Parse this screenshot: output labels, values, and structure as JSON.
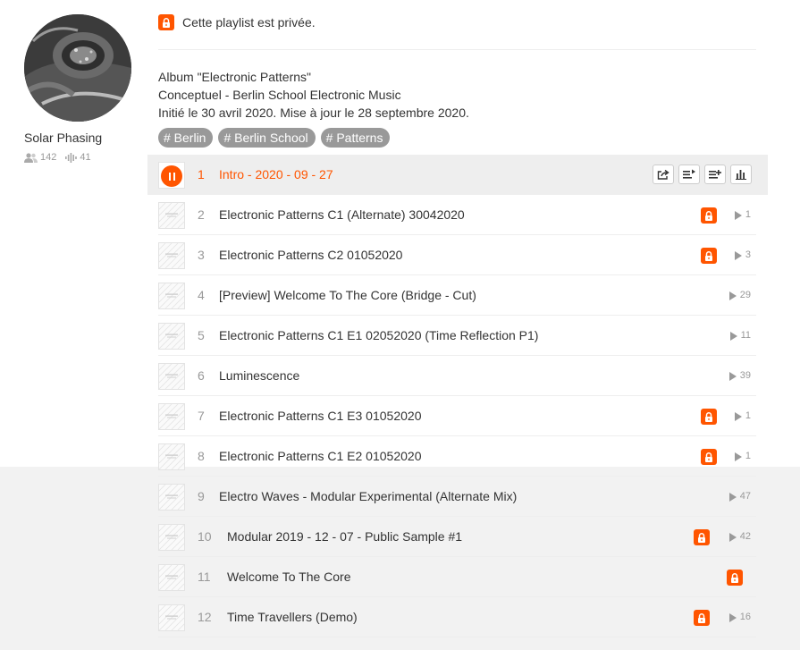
{
  "artist": {
    "name": "Solar Phasing",
    "followers": "142",
    "tracks": "41"
  },
  "privacy": {
    "text": "Cette playlist est privée."
  },
  "description": [
    "Album \"Electronic Patterns\"",
    "Conceptuel - Berlin School Electronic Music",
    "Initié le 30 avril 2020. Mise à jour le 28 septembre 2020."
  ],
  "tags": [
    "# Berlin",
    "# Berlin School",
    "# Patterns"
  ],
  "colors": {
    "accent": "#ff5500",
    "muted": "#999999"
  },
  "tracks": [
    {
      "num": "1",
      "title": "Intro - 2020 - 09 - 27",
      "playing": true,
      "locked": false,
      "plays": ""
    },
    {
      "num": "2",
      "title": "Electronic Patterns C1 (Alternate) 30042020",
      "playing": false,
      "locked": true,
      "plays": "1"
    },
    {
      "num": "3",
      "title": "Electronic Patterns C2 01052020",
      "playing": false,
      "locked": true,
      "plays": "3"
    },
    {
      "num": "4",
      "title": "[Preview] Welcome To The Core (Bridge - Cut)",
      "playing": false,
      "locked": false,
      "plays": "29"
    },
    {
      "num": "5",
      "title": "Electronic Patterns C1 E1 02052020 (Time Reflection P1)",
      "playing": false,
      "locked": false,
      "plays": "11"
    },
    {
      "num": "6",
      "title": "Luminescence",
      "playing": false,
      "locked": false,
      "plays": "39"
    },
    {
      "num": "7",
      "title": "Electronic Patterns C1 E3 01052020",
      "playing": false,
      "locked": true,
      "plays": "1"
    },
    {
      "num": "8",
      "title": "Electronic Patterns C1 E2 01052020",
      "playing": false,
      "locked": true,
      "plays": "1"
    },
    {
      "num": "9",
      "title": "Electro Waves - Modular Experimental (Alternate Mix)",
      "playing": false,
      "locked": false,
      "plays": "47"
    },
    {
      "num": "10",
      "title": "Modular 2019 - 12 - 07 - Public Sample #1",
      "playing": false,
      "locked": true,
      "plays": "42"
    },
    {
      "num": "11",
      "title": "Welcome To The Core",
      "playing": false,
      "locked": true,
      "plays": ""
    },
    {
      "num": "12",
      "title": "Time Travellers (Demo)",
      "playing": false,
      "locked": true,
      "plays": "16"
    }
  ],
  "actions": [
    {
      "name": "share-button",
      "icon": "share-icon"
    },
    {
      "name": "play-next-button",
      "icon": "play-next-icon"
    },
    {
      "name": "add-to-next-up-button",
      "icon": "add-to-queue-icon"
    },
    {
      "name": "stats-button",
      "icon": "stats-icon"
    }
  ]
}
